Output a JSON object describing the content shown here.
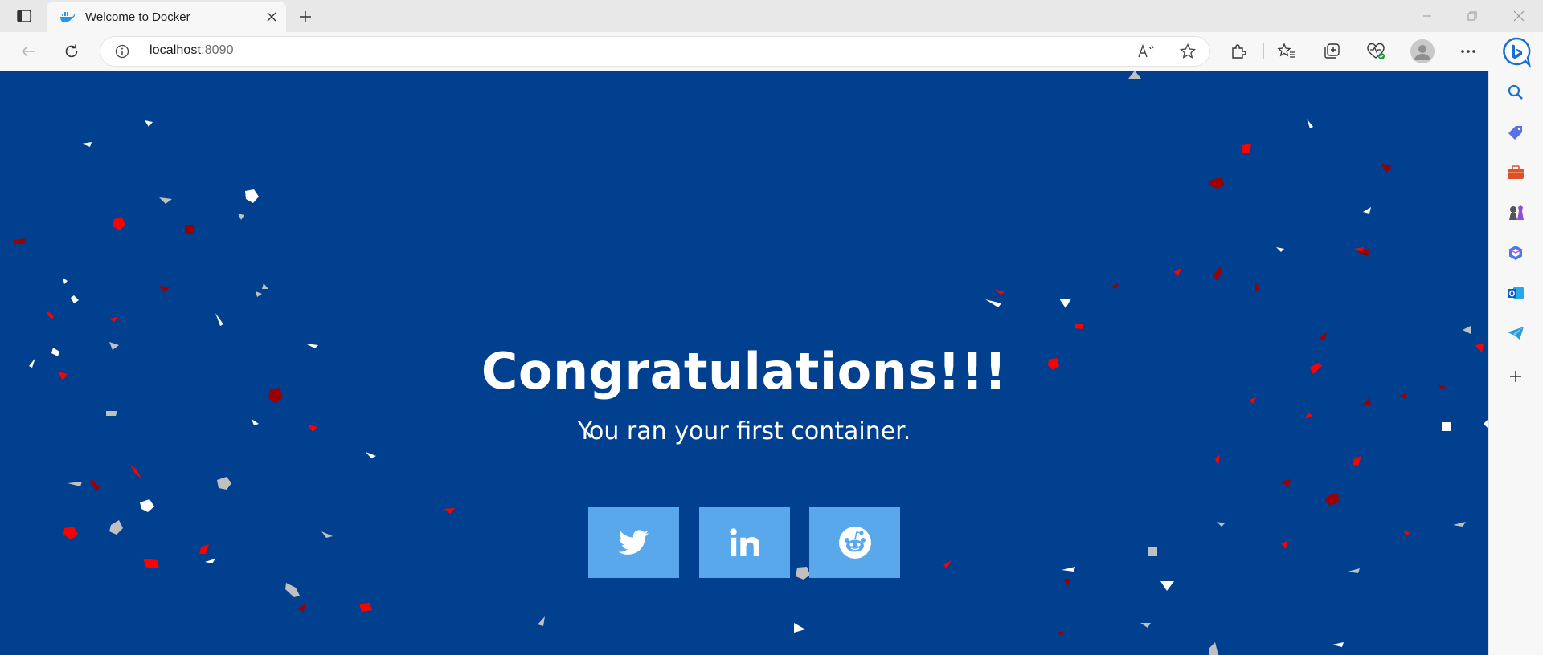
{
  "browser": {
    "tab": {
      "title": "Welcome to Docker",
      "favicon": "docker-whale-icon"
    },
    "address": {
      "host": "localhost",
      "port": ":8090"
    },
    "toolbar_icons": [
      "back-icon",
      "refresh-icon",
      "info-icon",
      "read-aloud-icon",
      "favorite-star-icon",
      "extensions-icon",
      "favorites-icon",
      "collections-icon",
      "browser-essentials-icon",
      "profile-icon",
      "more-icon",
      "bing-copilot-icon"
    ],
    "sidebar_icons": [
      "search-icon",
      "shopping-icon",
      "tools-icon",
      "games-icon",
      "microsoft-365-icon",
      "outlook-icon",
      "telegram-icon",
      "add-icon"
    ]
  },
  "page": {
    "headline": "Congratulations!!!",
    "subline": "You ran your first container.",
    "share_buttons": [
      "twitter-icon",
      "linkedin-icon",
      "reddit-icon"
    ],
    "colors": {
      "background": "#01408f",
      "button": "#5aa8ec",
      "confetti": [
        "#ff0000",
        "#9b0000",
        "#ffffff",
        "#c0c0c0"
      ]
    }
  }
}
